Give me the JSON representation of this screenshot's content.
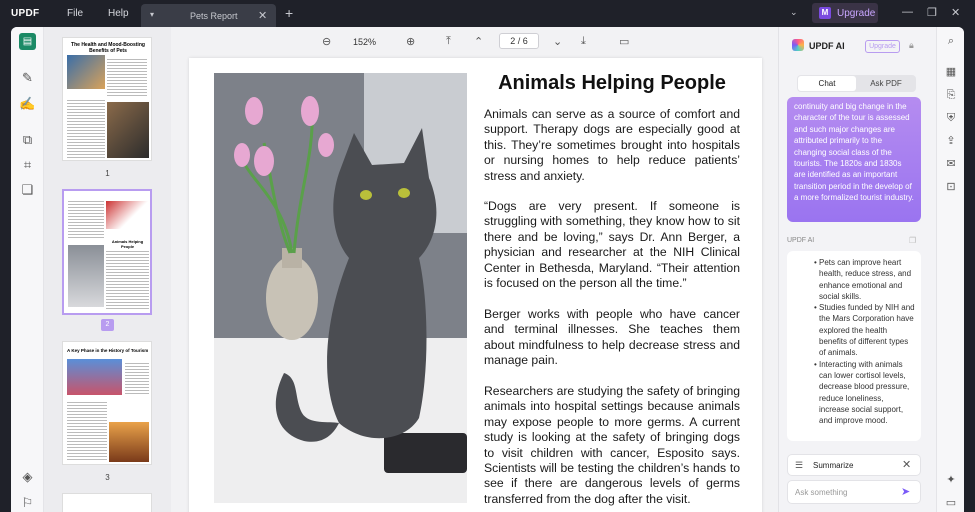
{
  "app": {
    "logo": "UPDF",
    "menu": [
      "File",
      "Help"
    ]
  },
  "tab": {
    "title": "Pets Report"
  },
  "upgrade": {
    "label": "Upgrade",
    "badge": "M"
  },
  "toolbar": {
    "zoom": "152%",
    "page_current": "2",
    "page_total": "6"
  },
  "thumbnails": [
    {
      "number": "1",
      "title": "The Health and Mood-Boosting Benefits of Pets"
    },
    {
      "number": "2",
      "title": "Animals Helping People"
    },
    {
      "number": "3",
      "title": "A Key Phase in the History of Tourism"
    }
  ],
  "page": {
    "title": "Animals Helping People",
    "paragraphs": [
      "Animals can serve as a source of comfort and support. Therapy dogs are especially good at this. They’re sometimes brought into hospitals or nursing homes to help reduce patients’ stress and anxiety.",
      "“Dogs are very present. If someone is struggling with something, they know how to sit there and be loving,” says Dr. Ann Berger, a physician and researcher at the NIH Clinical Center in Bethesda, Maryland. “Their attention is focused on the person all the time.”",
      "Berger works with people who have cancer and terminal illnesses. She teaches them about mindfulness to help decrease stress and manage pain.",
      "Researchers are studying the safety of bringing animals into hospital settings because animals may expose people to more germs. A current study is looking at the safety of bringing dogs to visit children with cancer, Esposito says. Scientists will be testing the children’s hands to see if there are dangerous levels of germs transferred from the dog after the visit."
    ]
  },
  "ai": {
    "title": "UPDF AI",
    "upgrade": "Upgrade",
    "tabs": [
      "Chat",
      "Ask PDF"
    ],
    "user_message": "continuity and big change in the character of the tour is assessed and such major changes are attributed primarily to the changing social class of the tourists. The 1820s and 1830s are identified as an important transition period in the develop of a more formalized tourist industry.",
    "response_label": "UPDF AI",
    "response_items": [
      "Pets can improve heart health, reduce stress, and enhance emotional and social skills.",
      "Studies funded by NIH and the Mars Corporation have explored the health benefits of different types of animals.",
      "Interacting with animals can lower cortisol levels, decrease blood pressure, reduce loneliness, increase social support, and improve mood."
    ],
    "summarize": "Summarize",
    "input_placeholder": "Ask something"
  }
}
